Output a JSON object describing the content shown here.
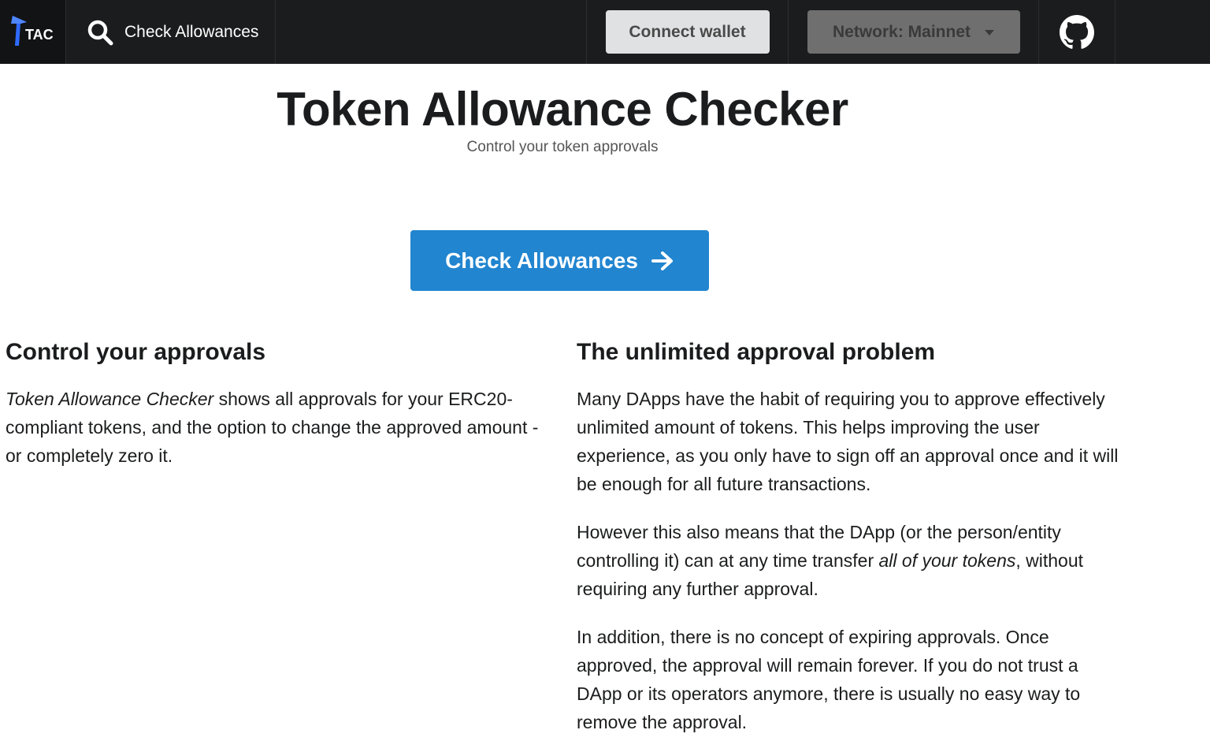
{
  "navbar": {
    "logo_text": "TAC",
    "check_label": "Check Allowances",
    "connect_wallet_label": "Connect wallet",
    "network_label": "Network: Mainnet"
  },
  "hero": {
    "title": "Token Allowance Checker",
    "subtitle": "Control your token approvals",
    "cta_label": "Check Allowances"
  },
  "left_section": {
    "heading": "Control your approvals",
    "p1_em": "Token Allowance Checker",
    "p1_rest": " shows all approvals for your ERC20-compliant tokens, and the option to change the approved amount - or completely zero it."
  },
  "right_section": {
    "heading": "The unlimited approval problem",
    "p1": "Many DApps have the habit of requiring you to approve effectively unlimited amount of tokens. This helps improving the user experience, as you only have to sign off an approval once and it will be enough for all future transactions.",
    "p2_a": "However this also means that the DApp (or the person/entity controlling it) can at any time transfer ",
    "p2_em": "all of your tokens",
    "p2_b": ", without requiring any further approval.",
    "p3": "In addition, there is no concept of expiring approvals. Once approved, the approval will remain forever. If you do not trust a DApp or its operators anymore, there is usually no easy way to remove the approval."
  },
  "colors": {
    "navbar_bg": "#1b1c1d",
    "primary_button": "#2185d0",
    "wallet_button": "#e0e1e2",
    "network_button": "#6f6f6f",
    "logo_accent": "#2f6bff"
  },
  "icons": {
    "logo": "tac-logo",
    "search": "search-icon",
    "dropdown": "caret-down-icon",
    "github": "github-icon",
    "arrow": "arrow-right-icon"
  }
}
